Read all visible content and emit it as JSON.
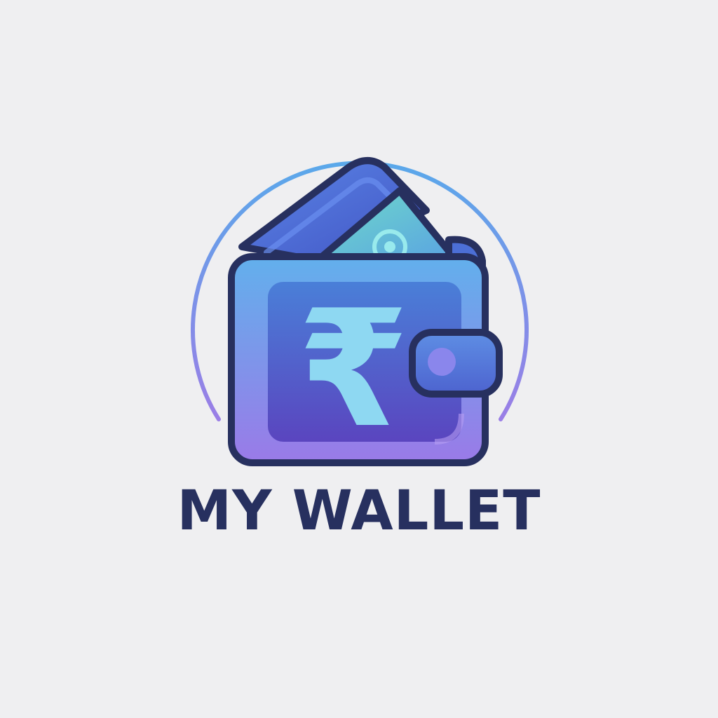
{
  "app": {
    "name": "MY WALLET"
  },
  "logo": {
    "icon": "wallet-icon",
    "currency_symbol": "₹",
    "currency_icon": "rupee-icon",
    "colors": {
      "background": "#efeff1",
      "outline": "#27305f",
      "wallet_top": "#5fa6e8",
      "wallet_bottom": "#8a78e6",
      "pocket_top": "#4b78d6",
      "pocket_bottom": "#5747bf",
      "banknote": "#5fd0c8",
      "card": "#4a66d8",
      "symbol": "#8fd8f0",
      "arc": "#6aa0e8",
      "text": "#27305f"
    }
  }
}
